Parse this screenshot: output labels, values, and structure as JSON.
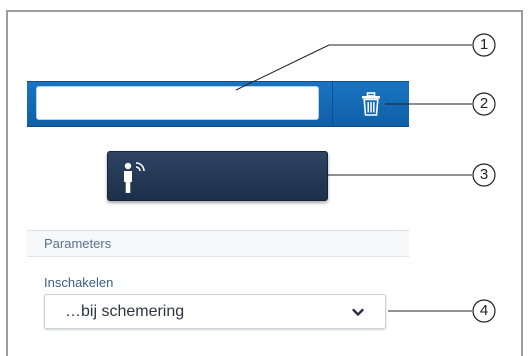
{
  "top_bar": {
    "name_input_value": "",
    "delete_icon": "trash-icon"
  },
  "sensor_button": {
    "icon": "person-sensor-icon"
  },
  "parameters": {
    "section_title": "Parameters",
    "switch_on_label": "Inschakelen",
    "switch_on_value": "…bij schemering"
  },
  "callouts": [
    "1",
    "2",
    "3",
    "4"
  ],
  "colors": {
    "top_bar": "#1269b6",
    "sensor_button": "#243a58",
    "frame_border": "#9c9c9c",
    "label_text": "#3a5f86"
  }
}
